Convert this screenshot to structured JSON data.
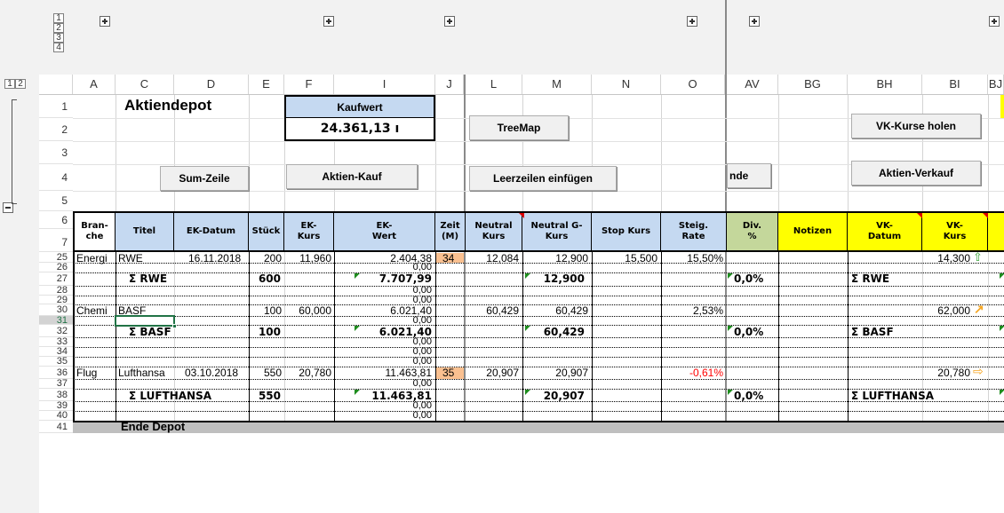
{
  "outline": {
    "levels": [
      "1",
      "2",
      "3",
      "4"
    ],
    "row_levels": [
      "1",
      "2"
    ]
  },
  "columns": [
    "A",
    "C",
    "D",
    "E",
    "F",
    "I",
    "J",
    "L",
    "M",
    "N",
    "O",
    "AV",
    "BG",
    "BH",
    "BI",
    "BJ"
  ],
  "rows": [
    "1",
    "2",
    "3",
    "4",
    "5",
    "6",
    "7",
    "25",
    "26",
    "27",
    "28",
    "29",
    "30",
    "31",
    "32",
    "33",
    "34",
    "35",
    "36",
    "37",
    "38",
    "39",
    "40",
    "41"
  ],
  "title": "Aktiendepot",
  "kaufwert": {
    "label": "Kaufwert",
    "value": "24.361,13 ı"
  },
  "buttons": {
    "treemap": "TreeMap",
    "vk_kurse": "VK-Kurse holen",
    "sum_zeile": "Sum-Zeile",
    "aktien_kauf": "Aktien-Kauf",
    "leerzeilen": "Leerzeilen einfügen",
    "ende": "nde",
    "aktien_verkauf": "Aktien-Verkauf"
  },
  "headers": {
    "branche": "Bran-\nche",
    "titel": "Titel",
    "ek_datum": "EK-Datum",
    "stueck": "Stück",
    "ek_kurs": "EK-\nKurs",
    "ek_wert": "EK-\nWert",
    "zeit": "Zeit\n(M)",
    "neutral_kurs": "Neutral\nKurs",
    "neutral_g_kurs": "Neutral G-\nKurs",
    "stop_kurs": "Stop Kurs",
    "steig_rate": "Steig.\nRate",
    "div": "Div.\n%",
    "notizen": "Notizen",
    "vk_datum": "VK-\nDatum",
    "vk_kurs": "VK-\nKurs"
  },
  "data": {
    "r25": {
      "branche": "Energi",
      "titel": "RWE",
      "ek_datum": "16.11.2018",
      "stueck": "200",
      "ek_kurs": "11,960",
      "ek_wert": "2.404,38",
      "zeit": "34",
      "neutral": "12,084",
      "neutral_g": "12,900",
      "stop": "15,500",
      "steig": "15,50%",
      "vk_kurs": "14,300"
    },
    "r26": {
      "ek_wert": "0,00"
    },
    "r27": {
      "titel": "Σ RWE",
      "stueck": "600",
      "ek_wert": "7.707,99",
      "neutral_g": "12,900",
      "div": "0,0%",
      "vk_datum": "Σ RWE"
    },
    "r28": {
      "ek_wert": "0,00"
    },
    "r29": {
      "ek_wert": "0,00"
    },
    "r30": {
      "branche": "Chemi",
      "titel": "BASF",
      "stueck": "100",
      "ek_kurs": "60,000",
      "ek_wert": "6.021,40",
      "neutral": "60,429",
      "neutral_g": "60,429",
      "steig": "2,53%",
      "vk_kurs": "62,000"
    },
    "r31": {
      "ek_wert": "0,00"
    },
    "r32": {
      "titel": "Σ BASF",
      "stueck": "100",
      "ek_wert": "6.021,40",
      "neutral_g": "60,429",
      "div": "0,0%",
      "vk_datum": "Σ BASF"
    },
    "r33": {
      "ek_wert": "0,00"
    },
    "r34": {
      "ek_wert": "0,00"
    },
    "r35": {
      "ek_wert": "0,00"
    },
    "r36": {
      "branche": "Flug",
      "titel": "Lufthansa",
      "ek_datum": "03.10.2018",
      "stueck": "550",
      "ek_kurs": "20,780",
      "ek_wert": "11.463,81",
      "zeit": "35",
      "neutral": "20,907",
      "neutral_g": "20,907",
      "steig": "-0,61%",
      "vk_kurs": "20,780"
    },
    "r37": {
      "ek_wert": "0,00"
    },
    "r38": {
      "titel": "Σ LUFTHANSA",
      "stueck": "550",
      "ek_wert": "11.463,81",
      "neutral_g": "20,907",
      "div": "0,0%",
      "vk_datum": "Σ LUFTHANSA"
    },
    "r39": {
      "ek_wert": "0,00"
    },
    "r40": {
      "ek_wert": "0,00"
    },
    "r41": {
      "titel": "Ende Depot"
    }
  },
  "colors": {
    "header_blue": "#c5d9f1",
    "zeit_orange": "#fac090",
    "div_green": "#c4d79b",
    "notes_yellow": "#ffff00",
    "select_green": "#217346",
    "arrow_green": "#2e9e2e",
    "arrow_orange": "#f5a623",
    "negative_red": "#ff0000"
  },
  "icons": {
    "rwe_trend": "arrow-up-icon",
    "basf_trend": "arrow-up-right-icon",
    "lufthansa_trend": "arrow-right-icon"
  }
}
